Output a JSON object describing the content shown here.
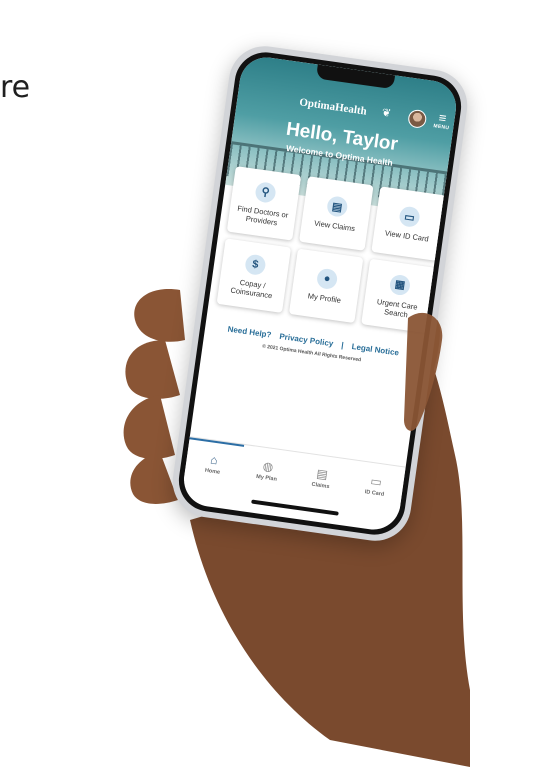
{
  "edge_text": "re",
  "app": {
    "logo_text": "OptimaHealth",
    "menu_label": "MENU",
    "greeting": "Hello, Taylor",
    "welcome": "Welcome to Optima Health"
  },
  "tiles": [
    {
      "label": "Find Doctors or Providers",
      "icon": "search-icon",
      "glyph": "⚲"
    },
    {
      "label": "View Claims",
      "icon": "document-icon",
      "glyph": "▤"
    },
    {
      "label": "View ID Card",
      "icon": "id-card-icon",
      "glyph": "▭"
    },
    {
      "label": "Copay / Coinsurance",
      "icon": "dollar-icon",
      "glyph": "$"
    },
    {
      "label": "My Profile",
      "icon": "person-icon",
      "glyph": "●"
    },
    {
      "label": "Urgent Care Search",
      "icon": "clinic-icon",
      "glyph": "▦"
    }
  ],
  "footer": {
    "need_help": "Need Help?",
    "privacy": "Privacy Policy",
    "separator": "|",
    "legal": "Legal Notice",
    "copyright": "© 2021 Optima Health All Rights Reserved"
  },
  "tabs": [
    {
      "label": "Home",
      "icon": "home-icon",
      "glyph": "⌂",
      "active": true
    },
    {
      "label": "My Plan",
      "icon": "globe-icon",
      "glyph": "◍",
      "active": false
    },
    {
      "label": "Claims",
      "icon": "claims-icon",
      "glyph": "▤",
      "active": false
    },
    {
      "label": "ID Card",
      "icon": "id-card-icon",
      "glyph": "▭",
      "active": false
    }
  ],
  "colors": {
    "accent": "#2c6ea5",
    "hero_top": "#2e7f88",
    "skin": "#7a4a2e"
  }
}
